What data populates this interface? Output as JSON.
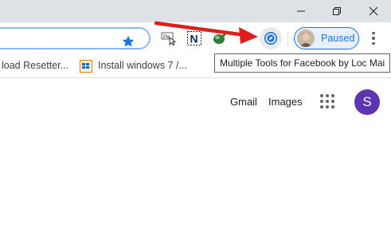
{
  "bookmarks": {
    "item1_label": "load Resetter...",
    "item2_label": "Install windows 7 /..."
  },
  "extensions": {
    "tooltip": "Multiple Tools for Facebook by Loc Mai"
  },
  "profile": {
    "status_label": "Paused"
  },
  "page": {
    "gmail_label": "Gmail",
    "images_label": "Images",
    "user_initial": "S"
  },
  "colors": {
    "accent_blue": "#1a73e8",
    "avatar_purple": "#5e35b1",
    "annotation_red": "#e01e1e"
  },
  "icons": [
    "minimize-icon",
    "restore-icon",
    "close-icon",
    "star-icon",
    "menu-icon",
    "apps-grid-icon"
  ]
}
